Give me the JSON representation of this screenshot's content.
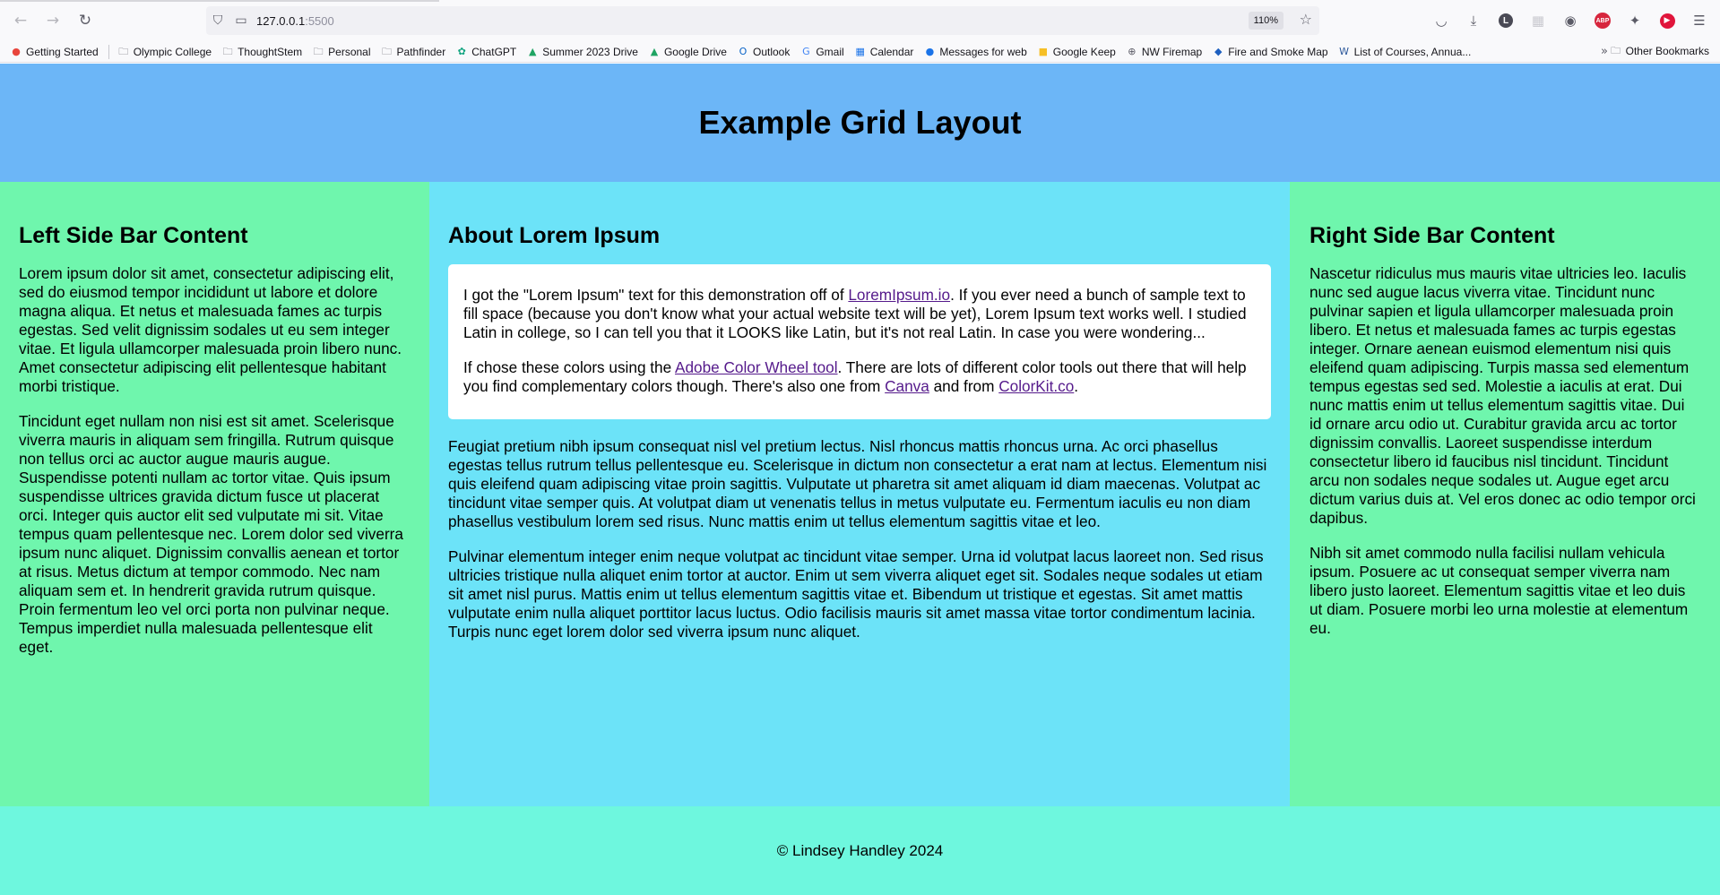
{
  "browser": {
    "url_host": "127.0.0.1",
    "url_port": ":5500",
    "zoom": "110%",
    "bookmarks": [
      {
        "label": "Getting Started",
        "icon": "firefox-icon",
        "color": "#e8453c"
      },
      {
        "label": "Olympic College",
        "icon": "folder-icon",
        "color": "#5b5b66"
      },
      {
        "label": "ThoughtStem",
        "icon": "folder-icon",
        "color": "#5b5b66"
      },
      {
        "label": "Personal",
        "icon": "folder-icon",
        "color": "#5b5b66"
      },
      {
        "label": "Pathfinder",
        "icon": "folder-icon",
        "color": "#5b5b66"
      },
      {
        "label": "ChatGPT",
        "icon": "chatgpt-icon",
        "color": "#10a37f"
      },
      {
        "label": "Summer 2023 Drive",
        "icon": "google-drive-icon",
        "color": "#1fa463"
      },
      {
        "label": "Google Drive",
        "icon": "google-drive-icon",
        "color": "#1fa463"
      },
      {
        "label": "Outlook",
        "icon": "outlook-icon",
        "color": "#0a64c8"
      },
      {
        "label": "Gmail",
        "icon": "google-icon",
        "color": "#4285f4"
      },
      {
        "label": "Calendar",
        "icon": "calendar-icon",
        "color": "#1a73e8"
      },
      {
        "label": "Messages for web",
        "icon": "messages-icon",
        "color": "#1a73e8"
      },
      {
        "label": "Google Keep",
        "icon": "keep-icon",
        "color": "#f6bf26"
      },
      {
        "label": "NW Firemap",
        "icon": "globe-icon",
        "color": "#5b5b66"
      },
      {
        "label": "Fire and Smoke Map",
        "icon": "fire-smoke-map-icon",
        "color": "#1d5fbf"
      },
      {
        "label": "List of Courses, Annua...",
        "icon": "word-icon",
        "color": "#2b579a"
      }
    ],
    "other_bookmarks": "Other Bookmarks"
  },
  "site": {
    "title": "Example Grid Layout",
    "left": {
      "heading": "Left Side Bar Content",
      "paragraphs": [
        "Lorem ipsum dolor sit amet, consectetur adipiscing elit, sed do eiusmod tempor incididunt ut labore et dolore magna aliqua. Et netus et malesuada fames ac turpis egestas. Sed velit dignissim sodales ut eu sem integer vitae. Et ligula ullamcorper malesuada proin libero nunc. Amet consectetur adipiscing elit pellentesque habitant morbi tristique.",
        "Tincidunt eget nullam non nisi est sit amet. Scelerisque viverra mauris in aliquam sem fringilla. Rutrum quisque non tellus orci ac auctor augue mauris augue. Suspendisse potenti nullam ac tortor vitae. Quis ipsum suspendisse ultrices gravida dictum fusce ut placerat orci. Integer quis auctor elit sed vulputate mi sit. Vitae tempus quam pellentesque nec. Lorem dolor sed viverra ipsum nunc aliquet. Dignissim convallis aenean et tortor at risus. Metus dictum at tempor commodo. Nec nam aliquam sem et. In hendrerit gravida rutrum quisque. Proin fermentum leo vel orci porta non pulvinar neque. Tempus imperdiet nulla malesuada pellentesque elit eget."
      ]
    },
    "main": {
      "heading": "About Lorem Ipsum",
      "card_p1_a": "I got the \"Lorem Ipsum\" text for this demonstration off of ",
      "card_p1_link": "LoremIpsum.io",
      "card_p1_b": ". If you ever need a bunch of sample text to fill space (because you don't know what your actual website text will be yet), Lorem Ipsum text works well. I studied Latin in college, so I can tell you that it LOOKS like Latin, but it's not real Latin. In case you were wondering...",
      "card_p2_a": "If chose these colors using the ",
      "card_p2_link1": "Adobe Color Wheel tool",
      "card_p2_b": ". There are lots of different color tools out there that will help you find complementary colors though. There's also one from ",
      "card_p2_link2": "Canva",
      "card_p2_c": " and from ",
      "card_p2_link3": "ColorKit.co",
      "card_p2_d": ".",
      "paragraphs": [
        "Feugiat pretium nibh ipsum consequat nisl vel pretium lectus. Nisl rhoncus mattis rhoncus urna. Ac orci phasellus egestas tellus rutrum tellus pellentesque eu. Scelerisque in dictum non consectetur a erat nam at lectus. Elementum nisi quis eleifend quam adipiscing vitae proin sagittis. Vulputate ut pharetra sit amet aliquam id diam maecenas. Volutpat ac tincidunt vitae semper quis. At volutpat diam ut venenatis tellus in metus vulputate eu. Fermentum iaculis eu non diam phasellus vestibulum lorem sed risus. Nunc mattis enim ut tellus elementum sagittis vitae et leo.",
        "Pulvinar elementum integer enim neque volutpat ac tincidunt vitae semper. Urna id volutpat lacus laoreet non. Sed risus ultricies tristique nulla aliquet enim tortor at auctor. Enim ut sem viverra aliquet eget sit. Sodales neque sodales ut etiam sit amet nisl purus. Mattis enim ut tellus elementum sagittis vitae et. Bibendum ut tristique et egestas. Sit amet mattis vulputate enim nulla aliquet porttitor lacus luctus. Odio facilisis mauris sit amet massa vitae tortor condimentum lacinia. Turpis nunc eget lorem dolor sed viverra ipsum nunc aliquet."
      ]
    },
    "right": {
      "heading": "Right Side Bar Content",
      "paragraphs": [
        "Nascetur ridiculus mus mauris vitae ultricies leo. Iaculis nunc sed augue lacus viverra vitae. Tincidunt nunc pulvinar sapien et ligula ullamcorper malesuada proin libero. Et netus et malesuada fames ac turpis egestas integer. Ornare aenean euismod elementum nisi quis eleifend quam adipiscing. Turpis massa sed elementum tempus egestas sed sed. Molestie a iaculis at erat. Dui nunc mattis enim ut tellus elementum sagittis vitae. Dui id ornare arcu odio ut. Curabitur gravida arcu ac tortor dignissim convallis. Laoreet suspendisse interdum consectetur libero id faucibus nisl tincidunt. Tincidunt arcu non sodales neque sodales ut. Augue eget arcu dictum varius duis at. Vel eros donec ac odio tempor orci dapibus.",
        "Nibh sit amet commodo nulla facilisi nullam vehicula ipsum. Posuere ac ut consequat semper viverra nam libero justo laoreet. Elementum sagittis vitae et leo duis ut diam. Posuere morbi leo urna molestie at elementum eu."
      ]
    },
    "footer": "© Lindsey Handley 2024",
    "colors": {
      "header": "#6cb6f7",
      "sidebars": "#6ff6ad",
      "main": "#6ce3f8",
      "footer": "#6ef7de",
      "link": "#551a8b"
    }
  }
}
